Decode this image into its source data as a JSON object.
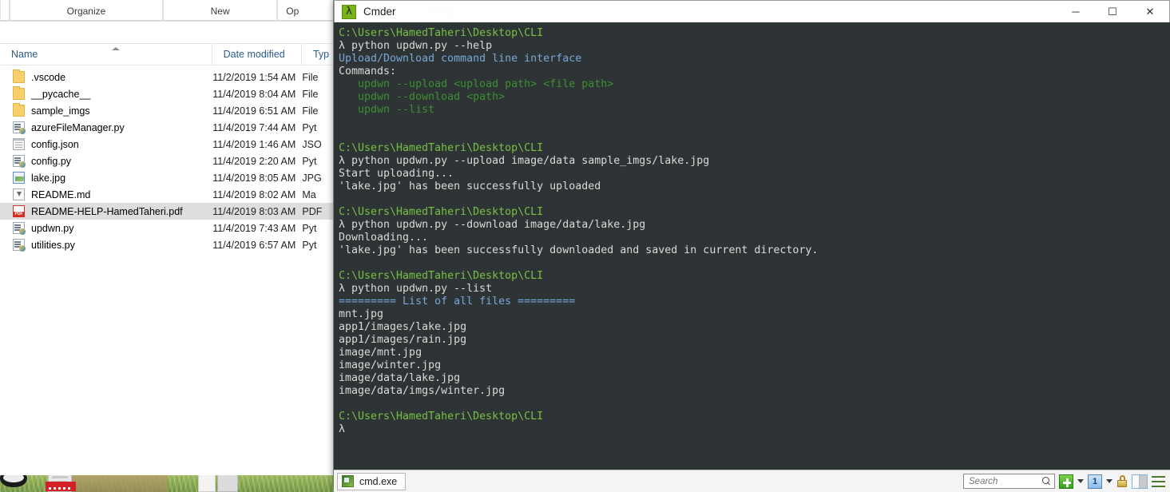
{
  "explorer": {
    "ribbon_groups": [
      "Organize",
      "New",
      "Op"
    ],
    "columns": [
      {
        "label": "Name",
        "sorted": true
      },
      {
        "label": "Date modified"
      },
      {
        "label": "Typ"
      }
    ],
    "files": [
      {
        "icon": "folder-icon",
        "name": ".vscode",
        "date": "11/2/2019 1:54 AM",
        "type": "File",
        "selected": false
      },
      {
        "icon": "folder-icon",
        "name": "__pycache__",
        "date": "11/4/2019 8:04 AM",
        "type": "File",
        "selected": false
      },
      {
        "icon": "folder-icon",
        "name": "sample_imgs",
        "date": "11/4/2019 6:51 AM",
        "type": "File",
        "selected": false
      },
      {
        "icon": "python-icon",
        "name": "azureFileManager.py",
        "date": "11/4/2019 7:44 AM",
        "type": "Pyt",
        "selected": false
      },
      {
        "icon": "json-icon",
        "name": "config.json",
        "date": "11/4/2019 1:46 AM",
        "type": "JSO",
        "selected": false
      },
      {
        "icon": "python-icon",
        "name": "config.py",
        "date": "11/4/2019 2:20 AM",
        "type": "Pyt",
        "selected": false
      },
      {
        "icon": "image-icon",
        "name": "lake.jpg",
        "date": "11/4/2019 8:05 AM",
        "type": "JPG",
        "selected": false
      },
      {
        "icon": "markdown-icon",
        "name": "README.md",
        "date": "11/4/2019 8:02 AM",
        "type": "Ma",
        "selected": false
      },
      {
        "icon": "pdf-icon",
        "name": "README-HELP-HamedTaheri.pdf",
        "date": "11/4/2019 8:03 AM",
        "type": "PDF",
        "selected": true
      },
      {
        "icon": "python-icon",
        "name": "updwn.py",
        "date": "11/4/2019 7:43 AM",
        "type": "Pyt",
        "selected": false
      },
      {
        "icon": "python-icon",
        "name": "utilities.py",
        "date": "11/4/2019 6:57 AM",
        "type": "Pyt",
        "selected": false
      }
    ]
  },
  "cmder": {
    "title": "Cmder",
    "logo_glyph": "λ",
    "ghost_text": "Select",
    "window_buttons": {
      "minimize": "─",
      "maximize": "☐",
      "close": "✕"
    },
    "terminal": {
      "prompt_path": "C:\\Users\\HamedTaheri\\Desktop\\CLI",
      "prompt_symbol": "λ",
      "lines": [
        {
          "text": "C:\\Users\\HamedTaheri\\Desktop\\CLI",
          "color": "green"
        },
        {
          "text": "λ python updwn.py --help",
          "color": "white"
        },
        {
          "text": "Upload/Download command line interface",
          "color": "blue"
        },
        {
          "text": "Commands:",
          "color": "white"
        },
        {
          "text": "   updwn --upload <upload path> <file path>",
          "color": "cmd"
        },
        {
          "text": "   updwn --download <path>",
          "color": "cmd"
        },
        {
          "text": "   updwn --list",
          "color": "cmd"
        },
        {
          "text": "",
          "color": "white"
        },
        {
          "text": "",
          "color": "white"
        },
        {
          "text": "C:\\Users\\HamedTaheri\\Desktop\\CLI",
          "color": "green"
        },
        {
          "text": "λ python updwn.py --upload image/data sample_imgs/lake.jpg",
          "color": "white"
        },
        {
          "text": "Start uploading...",
          "color": "white"
        },
        {
          "text": "'lake.jpg' has been successfully uploaded",
          "color": "white"
        },
        {
          "text": "",
          "color": "white"
        },
        {
          "text": "C:\\Users\\HamedTaheri\\Desktop\\CLI",
          "color": "green"
        },
        {
          "text": "λ python updwn.py --download image/data/lake.jpg",
          "color": "white"
        },
        {
          "text": "Downloading...",
          "color": "white"
        },
        {
          "text": "'lake.jpg' has been successfully downloaded and saved in current directory.",
          "color": "white"
        },
        {
          "text": "",
          "color": "white"
        },
        {
          "text": "C:\\Users\\HamedTaheri\\Desktop\\CLI",
          "color": "green"
        },
        {
          "text": "λ python updwn.py --list",
          "color": "white"
        },
        {
          "text": "========= List of all files =========",
          "color": "blue"
        },
        {
          "text": "mnt.jpg",
          "color": "white"
        },
        {
          "text": "app1/images/lake.jpg",
          "color": "white"
        },
        {
          "text": "app1/images/rain.jpg",
          "color": "white"
        },
        {
          "text": "image/mnt.jpg",
          "color": "white"
        },
        {
          "text": "image/winter.jpg",
          "color": "white"
        },
        {
          "text": "image/data/lake.jpg",
          "color": "white"
        },
        {
          "text": "image/data/imgs/winter.jpg",
          "color": "white"
        },
        {
          "text": "",
          "color": "white"
        },
        {
          "text": "C:\\Users\\HamedTaheri\\Desktop\\CLI",
          "color": "green"
        },
        {
          "text": "λ",
          "color": "white"
        }
      ]
    },
    "status_bar": {
      "tab_label": "cmd.exe",
      "search_placeholder": "Search",
      "search_value": "",
      "new_console_label": "+",
      "active_console_number": "1"
    }
  },
  "colors": {
    "terminal_bg": "#2e3436",
    "prompt_green": "#78c043",
    "info_blue": "#7aa6d6",
    "command_green": "#3e8f2e",
    "text_white": "#d8dcd6",
    "selection_gray": "#dedede"
  }
}
